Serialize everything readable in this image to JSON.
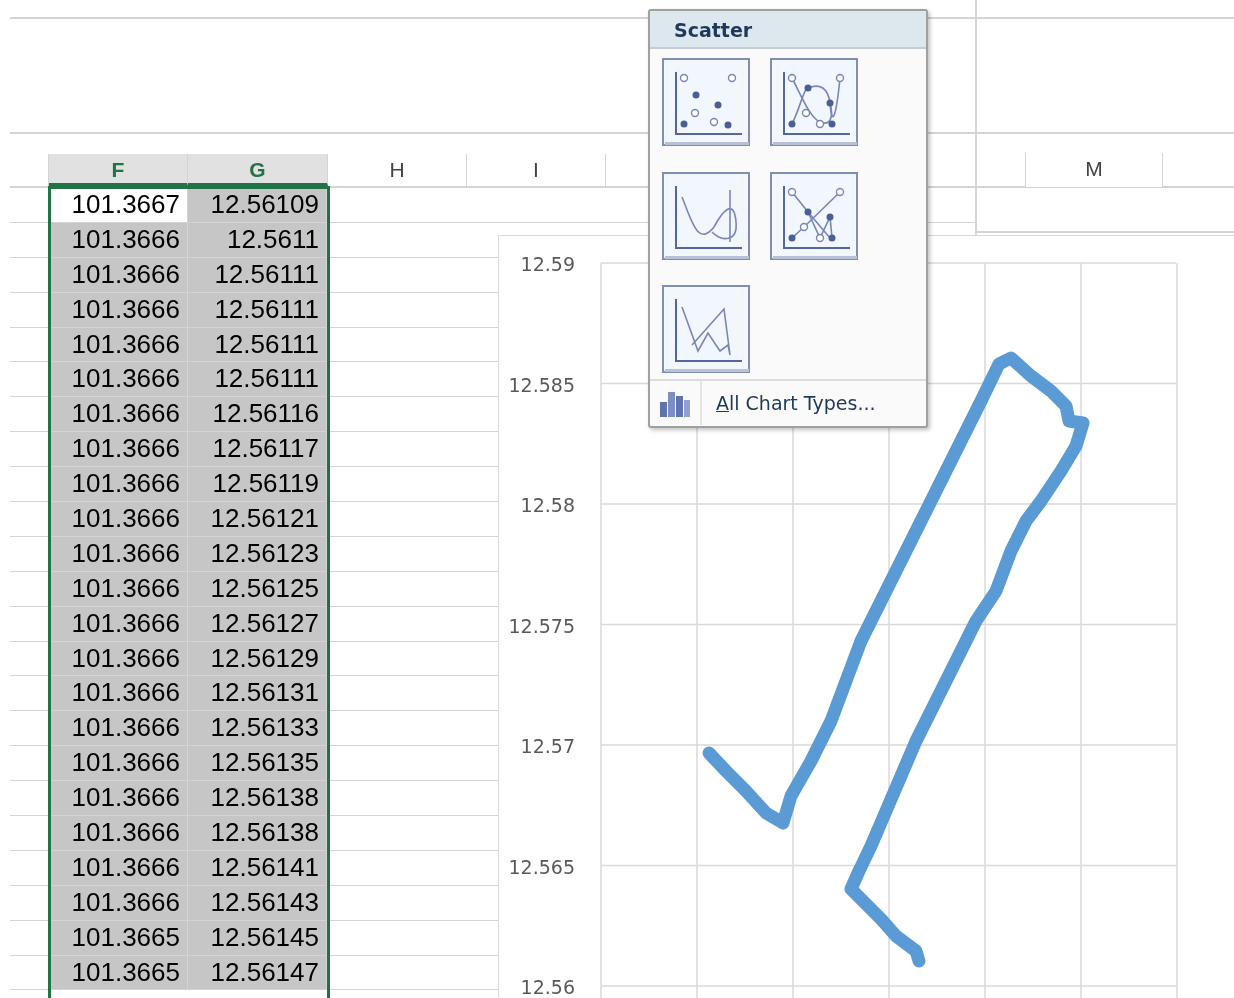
{
  "sheet": {
    "columns": [
      {
        "label": "F",
        "selected": true
      },
      {
        "label": "G",
        "selected": true
      },
      {
        "label": "H",
        "selected": false
      },
      {
        "label": "I",
        "selected": false
      },
      {
        "label": "M",
        "selected": false
      }
    ],
    "rows": [
      {
        "cells": [
          {
            "value": "101.3667",
            "active": true
          },
          {
            "value": "12.56109",
            "active": false
          }
        ]
      },
      {
        "cells": [
          {
            "value": "101.3666",
            "active": false
          },
          {
            "value": "12.5611",
            "active": false
          }
        ]
      },
      {
        "cells": [
          {
            "value": "101.3666",
            "active": false
          },
          {
            "value": "12.56111",
            "active": false
          }
        ]
      },
      {
        "cells": [
          {
            "value": "101.3666",
            "active": false
          },
          {
            "value": "12.56111",
            "active": false
          }
        ]
      },
      {
        "cells": [
          {
            "value": "101.3666",
            "active": false
          },
          {
            "value": "12.56111",
            "active": false
          }
        ]
      },
      {
        "cells": [
          {
            "value": "101.3666",
            "active": false
          },
          {
            "value": "12.56111",
            "active": false
          }
        ]
      },
      {
        "cells": [
          {
            "value": "101.3666",
            "active": false
          },
          {
            "value": "12.56116",
            "active": false
          }
        ]
      },
      {
        "cells": [
          {
            "value": "101.3666",
            "active": false
          },
          {
            "value": "12.56117",
            "active": false
          }
        ]
      },
      {
        "cells": [
          {
            "value": "101.3666",
            "active": false
          },
          {
            "value": "12.56119",
            "active": false
          }
        ]
      },
      {
        "cells": [
          {
            "value": "101.3666",
            "active": false
          },
          {
            "value": "12.56121",
            "active": false
          }
        ]
      },
      {
        "cells": [
          {
            "value": "101.3666",
            "active": false
          },
          {
            "value": "12.56123",
            "active": false
          }
        ]
      },
      {
        "cells": [
          {
            "value": "101.3666",
            "active": false
          },
          {
            "value": "12.56125",
            "active": false
          }
        ]
      },
      {
        "cells": [
          {
            "value": "101.3666",
            "active": false
          },
          {
            "value": "12.56127",
            "active": false
          }
        ]
      },
      {
        "cells": [
          {
            "value": "101.3666",
            "active": false
          },
          {
            "value": "12.56129",
            "active": false
          }
        ]
      },
      {
        "cells": [
          {
            "value": "101.3666",
            "active": false
          },
          {
            "value": "12.56131",
            "active": false
          }
        ]
      },
      {
        "cells": [
          {
            "value": "101.3666",
            "active": false
          },
          {
            "value": "12.56133",
            "active": false
          }
        ]
      },
      {
        "cells": [
          {
            "value": "101.3666",
            "active": false
          },
          {
            "value": "12.56135",
            "active": false
          }
        ]
      },
      {
        "cells": [
          {
            "value": "101.3666",
            "active": false
          },
          {
            "value": "12.56138",
            "active": false
          }
        ]
      },
      {
        "cells": [
          {
            "value": "101.3666",
            "active": false
          },
          {
            "value": "12.56138",
            "active": false
          }
        ]
      },
      {
        "cells": [
          {
            "value": "101.3666",
            "active": false
          },
          {
            "value": "12.56141",
            "active": false
          }
        ]
      },
      {
        "cells": [
          {
            "value": "101.3666",
            "active": false
          },
          {
            "value": "12.56143",
            "active": false
          }
        ]
      },
      {
        "cells": [
          {
            "value": "101.3665",
            "active": false
          },
          {
            "value": "12.56145",
            "active": false
          }
        ]
      },
      {
        "cells": [
          {
            "value": "101.3665",
            "active": false
          },
          {
            "value": "12.56147",
            "active": false
          }
        ]
      }
    ]
  },
  "chart": {
    "y_labels": [
      "12.59",
      "12.585",
      "12.58",
      "12.575",
      "12.57",
      "12.565",
      "12.56"
    ]
  },
  "scatter_menu": {
    "title": "Scatter",
    "options": [
      {
        "kind": "markers"
      },
      {
        "kind": "smooth-markers"
      },
      {
        "kind": "smooth"
      },
      {
        "kind": "straight-markers"
      },
      {
        "kind": "straight"
      }
    ],
    "footer_link": "All Chart Types..."
  }
}
